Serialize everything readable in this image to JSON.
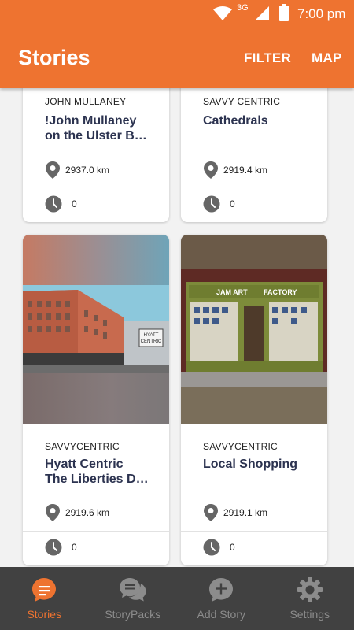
{
  "status_bar": {
    "network": "3G",
    "time": "7:00 pm"
  },
  "app_bar": {
    "title": "Stories",
    "filter_label": "FILTER",
    "map_label": "MAP"
  },
  "stories": [
    {
      "author": "JOHN MULLANEY",
      "title_line1": "!John Mullaney",
      "title_line2": "on the Ulster B…",
      "distance": "2937.0 km",
      "duration": "0"
    },
    {
      "author": "SAVVY CENTRIC",
      "title_line1": "Cathedrals",
      "title_line2": "",
      "distance": "2919.4 km",
      "duration": "0"
    },
    {
      "author": "SAVVYCENTRIC",
      "title_line1": "Hyatt Centric",
      "title_line2": "The Liberties D…",
      "distance": "2919.6 km",
      "duration": "0"
    },
    {
      "author": "SAVVYCENTRIC",
      "title_line1": "Local Shopping",
      "title_line2": "",
      "distance": "2919.1 km",
      "duration": "0"
    }
  ],
  "images": {
    "hotel_sign": "HYATT\nCENTRIC",
    "shop_sign": "JAM ART FACTORY"
  },
  "bottom_nav": [
    {
      "label": "Stories",
      "icon": "stories-chat-icon",
      "active": true
    },
    {
      "label": "StoryPacks",
      "icon": "storypacks-chat-icon",
      "active": false
    },
    {
      "label": "Add Story",
      "icon": "add-story-icon",
      "active": false
    },
    {
      "label": "Settings",
      "icon": "settings-gear-icon",
      "active": false
    }
  ],
  "colors": {
    "primary": "#ee7330",
    "nav_bg": "#414141",
    "nav_inactive": "#8c8c8c",
    "title_text": "#2c3350"
  }
}
